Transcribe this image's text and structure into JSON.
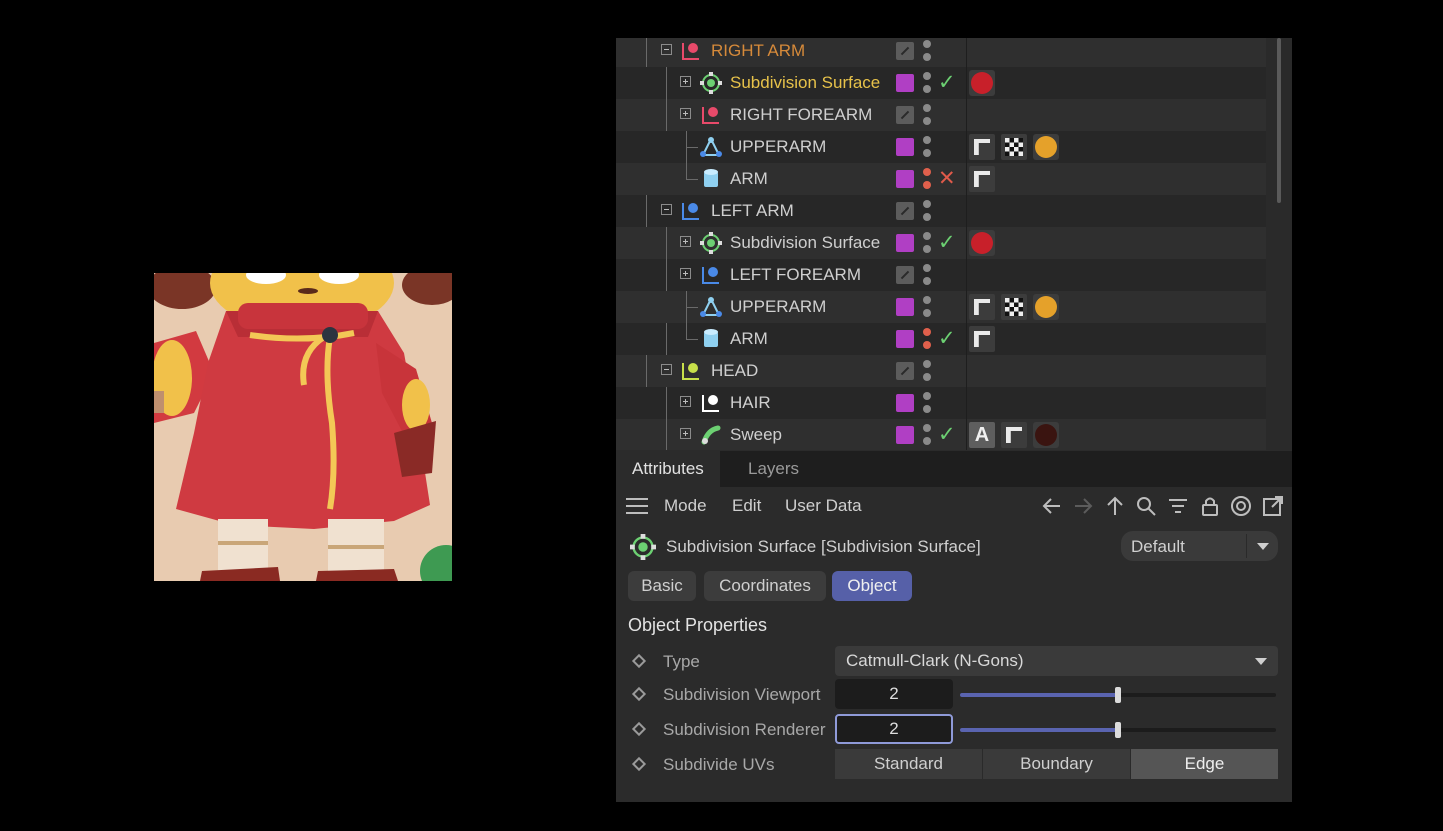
{
  "object_manager": {
    "rows": [
      {
        "name": "RIGHT ARM",
        "icon": "null-object-icon",
        "icon_color": "#e84a6a",
        "name_style": "orange",
        "layer": "gray",
        "expander": "minus"
      },
      {
        "name": "Subdivision Surface",
        "icon": "subdivision-surface-icon",
        "icon_color": "#6cd072",
        "name_style": "yellow",
        "layer": "purple",
        "status": "✓",
        "tags": [
          {
            "type": "material",
            "color": "#c8202a"
          }
        ],
        "expander": "plus"
      },
      {
        "name": "RIGHT FOREARM",
        "icon": "null-object-icon",
        "icon_color": "#e84a6a",
        "name_style": "normal",
        "layer": "gray",
        "expander": "plus"
      },
      {
        "name": "UPPERARM",
        "icon": "polygon-object-icon",
        "icon_color": "#8fd0f0",
        "name_style": "normal",
        "layer": "purple",
        "tags": [
          {
            "type": "phong"
          },
          {
            "type": "checker"
          },
          {
            "type": "material",
            "color": "#e5a12a"
          }
        ]
      },
      {
        "name": "ARM",
        "icon": "cylinder-icon",
        "icon_color": "#8fd0f0",
        "name_style": "normal",
        "layer": "purple",
        "dots_red": true,
        "status": "✕",
        "tags": [
          {
            "type": "phong"
          }
        ]
      },
      {
        "name": "LEFT ARM",
        "icon": "null-object-icon",
        "icon_color": "#4a8ae8",
        "name_style": "normal",
        "layer": "gray",
        "expander": "minus"
      },
      {
        "name": "Subdivision Surface",
        "icon": "subdivision-surface-icon",
        "icon_color": "#6cd072",
        "name_style": "normal",
        "layer": "purple",
        "status": "✓",
        "tags": [
          {
            "type": "material",
            "color": "#c8202a"
          }
        ],
        "expander": "plus"
      },
      {
        "name": "LEFT FOREARM",
        "icon": "null-object-icon",
        "icon_color": "#4a8ae8",
        "name_style": "normal",
        "layer": "gray",
        "expander": "plus"
      },
      {
        "name": "UPPERARM",
        "icon": "polygon-object-icon",
        "icon_color": "#8fd0f0",
        "name_style": "normal",
        "layer": "purple",
        "tags": [
          {
            "type": "phong"
          },
          {
            "type": "checker"
          },
          {
            "type": "material",
            "color": "#e5a12a"
          }
        ]
      },
      {
        "name": "ARM",
        "icon": "cylinder-icon",
        "icon_color": "#8fd0f0",
        "name_style": "normal",
        "layer": "purple",
        "dots_red": true,
        "status": "✓",
        "tags": [
          {
            "type": "phong"
          }
        ]
      },
      {
        "name": "HEAD",
        "icon": "null-object-icon",
        "icon_color": "#c8e04a",
        "name_style": "normal",
        "layer": "gray",
        "expander": "minus"
      },
      {
        "name": "HAIR",
        "icon": "null-object-icon",
        "icon_color": "#ffffff",
        "name_style": "normal",
        "layer": "purple",
        "expander": "plus"
      },
      {
        "name": "Sweep",
        "icon": "sweep-icon",
        "icon_color": "#6cd072",
        "name_style": "normal",
        "layer": "purple",
        "status": "✓",
        "tags": [
          {
            "type": "text",
            "label": "A"
          },
          {
            "type": "phong"
          },
          {
            "type": "material",
            "color": "#3a1410"
          }
        ],
        "expander": "plus"
      }
    ]
  },
  "tabs": [
    {
      "label": "Attributes",
      "active": true
    },
    {
      "label": "Layers",
      "active": false
    }
  ],
  "menu": {
    "items": [
      "Mode",
      "Edit",
      "User Data"
    ],
    "tools": [
      "arrow-left-icon",
      "arrow-right-icon",
      "arrow-up-icon",
      "search-icon",
      "filter-icon",
      "lock-icon",
      "target-icon",
      "new-window-icon"
    ]
  },
  "header": {
    "title": "Subdivision Surface [Subdivision Surface]",
    "icon": "subdivision-surface-icon",
    "preset": "Default"
  },
  "property_tabs": [
    {
      "label": "Basic",
      "selected": false
    },
    {
      "label": "Coordinates",
      "selected": false
    },
    {
      "label": "Object",
      "selected": true
    }
  ],
  "section_title": "Object Properties",
  "properties": {
    "type": {
      "label": "Type",
      "value": "Catmull-Clark (N-Gons)"
    },
    "viewport": {
      "label": "Subdivision Viewport",
      "value": "2",
      "slider_fraction": 0.5
    },
    "renderer": {
      "label": "Subdivision Renderer",
      "value": "2",
      "slider_fraction": 0.5
    },
    "uvs": {
      "label": "Subdivide UVs",
      "options": [
        "Standard",
        "Boundary",
        "Edge"
      ],
      "selected": "Edge"
    }
  },
  "colors": {
    "accent": "#5660a8",
    "check": "#6cd072",
    "cross": "#e05a4a",
    "layer": "#b03fc4"
  }
}
